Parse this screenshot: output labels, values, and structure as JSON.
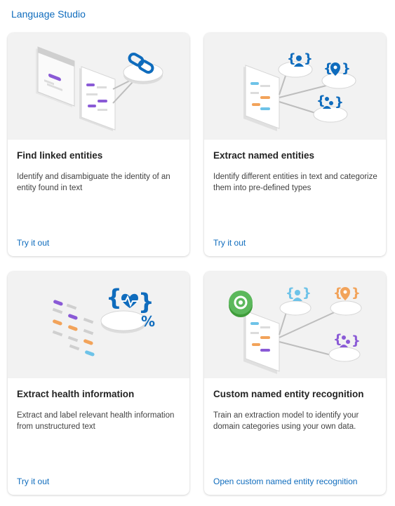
{
  "app": {
    "title": "Language Studio"
  },
  "cards": [
    {
      "title": "Find linked entities",
      "description": "Identify and disambiguate the identity of an entity found in text",
      "link": "Try it out"
    },
    {
      "title": "Extract named entities",
      "description": "Identify different entities in text and categorize them into pre-defined types",
      "link": "Try it out"
    },
    {
      "title": "Extract health information",
      "description": "Extract and label relevant health information from unstructured text",
      "link": "Try it out"
    },
    {
      "title": "Custom named entity recognition",
      "description": "Train an extraction model to identify your domain categories using your own data.",
      "link": "Open custom named entity recognition"
    }
  ],
  "icons": {
    "card1": [
      "document-stack-icon",
      "link-icon"
    ],
    "card2": [
      "document-icon",
      "person-entity-icon",
      "location-entity-icon",
      "people-entity-icon"
    ],
    "card3": [
      "health-heart-icon",
      "percent-icon"
    ],
    "card4": [
      "gear-settings-icon",
      "person-entity-icon",
      "location-entity-icon",
      "people-entity-icon"
    ]
  },
  "colors": {
    "accent": "#0f6cbd",
    "purple": "#8a5ad6",
    "orange": "#f2a35a",
    "light_blue": "#6ec3e8",
    "green": "#5cb85c"
  }
}
